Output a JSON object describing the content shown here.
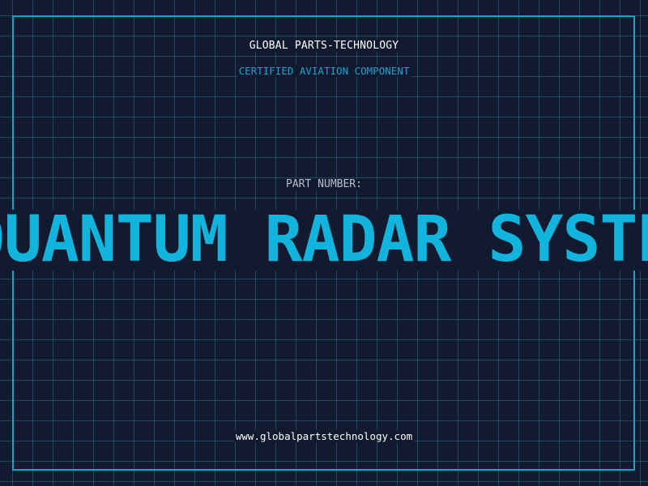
{
  "brand": "GLOBAL PARTS-TECHNOLOGY",
  "subtitle": "CERTIFIED AVIATION COMPONENT",
  "part_label": "PART NUMBER:",
  "part_value": "QUANTUM RADAR SYSTEM",
  "website": "www.globalpartstechnology.com",
  "colors": {
    "background": "#111a2f",
    "grid": "#1e5a72",
    "accent": "#12b4dd",
    "frame": "#12a6cc",
    "text": "#ffffff",
    "muted": "#b8c0cc"
  }
}
